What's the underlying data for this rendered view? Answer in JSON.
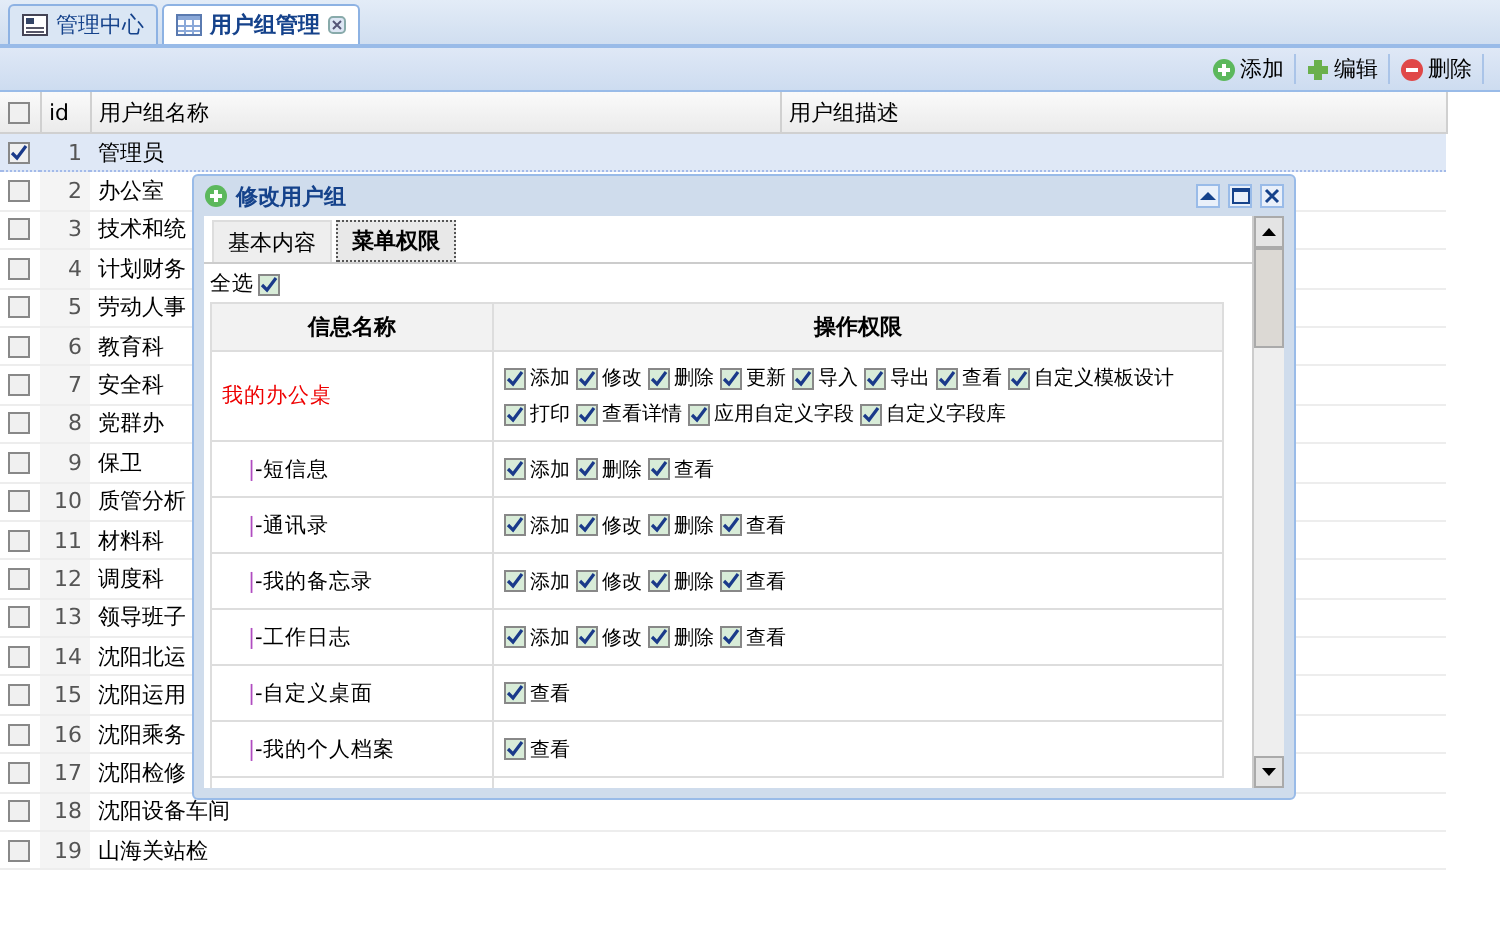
{
  "tabs": [
    {
      "label": "管理中心",
      "kind": "home",
      "selected": false,
      "closable": false
    },
    {
      "label": "用户组管理",
      "kind": "grid",
      "selected": true,
      "closable": true
    }
  ],
  "toolbar": [
    {
      "label": "添加",
      "kind": "add"
    },
    {
      "label": "编辑",
      "kind": "edit"
    },
    {
      "label": "删除",
      "kind": "delete"
    }
  ],
  "grid": {
    "header_checked": false,
    "columns": [
      "id",
      "用户组名称",
      "用户组描述"
    ],
    "rows": [
      {
        "id": "1",
        "name": "管理员",
        "checked": true,
        "selected": true
      },
      {
        "id": "2",
        "name": "办公室",
        "checked": false,
        "selected": false
      },
      {
        "id": "3",
        "name": "技术和统",
        "checked": false,
        "selected": false
      },
      {
        "id": "4",
        "name": "计划财务",
        "checked": false,
        "selected": false
      },
      {
        "id": "5",
        "name": "劳动人事",
        "checked": false,
        "selected": false
      },
      {
        "id": "6",
        "name": "教育科",
        "checked": false,
        "selected": false
      },
      {
        "id": "7",
        "name": "安全科",
        "checked": false,
        "selected": false
      },
      {
        "id": "8",
        "name": "党群办",
        "checked": false,
        "selected": false
      },
      {
        "id": "9",
        "name": "保卫",
        "checked": false,
        "selected": false
      },
      {
        "id": "10",
        "name": "质管分析",
        "checked": false,
        "selected": false
      },
      {
        "id": "11",
        "name": "材料科",
        "checked": false,
        "selected": false
      },
      {
        "id": "12",
        "name": "调度科",
        "checked": false,
        "selected": false
      },
      {
        "id": "13",
        "name": "领导班子",
        "checked": false,
        "selected": false
      },
      {
        "id": "14",
        "name": "沈阳北运",
        "checked": false,
        "selected": false
      },
      {
        "id": "15",
        "name": "沈阳运用",
        "checked": false,
        "selected": false
      },
      {
        "id": "16",
        "name": "沈阳乘务",
        "checked": false,
        "selected": false
      },
      {
        "id": "17",
        "name": "沈阳检修",
        "checked": false,
        "selected": false
      },
      {
        "id": "18",
        "name": "沈阳设备车间",
        "checked": false,
        "selected": false
      },
      {
        "id": "19",
        "name": "山海关站检",
        "checked": false,
        "selected": false
      }
    ]
  },
  "dialog": {
    "title": "修改用户组",
    "tabs": [
      {
        "label": "基本内容",
        "selected": false
      },
      {
        "label": "菜单权限",
        "selected": true
      }
    ],
    "select_all": {
      "label": "全选",
      "checked": true
    },
    "columns": [
      "信息名称",
      "操作权限"
    ],
    "rows": [
      {
        "name": "我的办公桌",
        "kind": "parent",
        "options": [
          {
            "label": "添加",
            "checked": true
          },
          {
            "label": "修改",
            "checked": true
          },
          {
            "label": "删除",
            "checked": true
          },
          {
            "label": "更新",
            "checked": true
          },
          {
            "label": "导入",
            "checked": true
          },
          {
            "label": "导出",
            "checked": true
          },
          {
            "label": "查看",
            "checked": true
          },
          {
            "label": "自定义模板设计",
            "checked": true
          },
          {
            "label": "打印",
            "checked": true
          },
          {
            "label": "查看详情",
            "checked": true
          },
          {
            "label": "应用自定义字段",
            "checked": true
          },
          {
            "label": "自定义字段库",
            "checked": true
          }
        ]
      },
      {
        "name": "-短信息",
        "kind": "child",
        "marker": "|",
        "options": [
          {
            "label": "添加",
            "checked": true
          },
          {
            "label": "删除",
            "checked": true
          },
          {
            "label": "查看",
            "checked": true
          }
        ]
      },
      {
        "name": "-通讯录",
        "kind": "child",
        "marker": "|",
        "options": [
          {
            "label": "添加",
            "checked": true
          },
          {
            "label": "修改",
            "checked": true
          },
          {
            "label": "删除",
            "checked": true
          },
          {
            "label": "查看",
            "checked": true
          }
        ]
      },
      {
        "name": "-我的备忘录",
        "kind": "child",
        "marker": "|",
        "options": [
          {
            "label": "添加",
            "checked": true
          },
          {
            "label": "修改",
            "checked": true
          },
          {
            "label": "删除",
            "checked": true
          },
          {
            "label": "查看",
            "checked": true
          }
        ]
      },
      {
        "name": "-工作日志",
        "kind": "child",
        "marker": "|",
        "options": [
          {
            "label": "添加",
            "checked": true
          },
          {
            "label": "修改",
            "checked": true
          },
          {
            "label": "删除",
            "checked": true
          },
          {
            "label": "查看",
            "checked": true
          }
        ]
      },
      {
        "name": "-自定义桌面",
        "kind": "child",
        "marker": "|",
        "options": [
          {
            "label": "查看",
            "checked": true
          }
        ]
      },
      {
        "name": "-我的个人档案",
        "kind": "child",
        "marker": "|",
        "options": [
          {
            "label": "查看",
            "checked": true
          }
        ]
      }
    ]
  }
}
